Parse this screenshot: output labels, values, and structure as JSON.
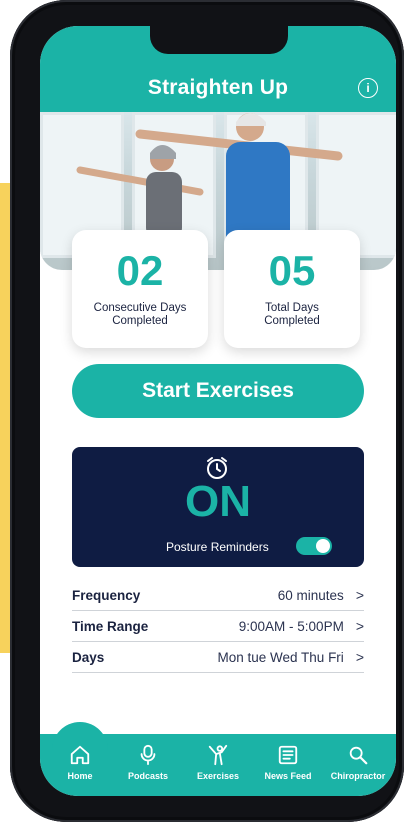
{
  "app": {
    "title": "Straighten Up",
    "info_icon": "info-icon"
  },
  "stats": [
    {
      "value": "02",
      "label": "Consecutive Days Completed"
    },
    {
      "value": "05",
      "label": "Total Days Completed"
    }
  ],
  "actions": {
    "start_label": "Start Exercises"
  },
  "reminder": {
    "status": "ON",
    "label": "Posture Reminders",
    "icon": "alarm-clock-icon",
    "enabled": true
  },
  "settings": [
    {
      "label": "Frequency",
      "value": "60 minutes"
    },
    {
      "label": "Time Range",
      "value": "9:00AM - 5:00PM"
    },
    {
      "label": "Days",
      "value": "Mon tue Wed Thu Fri"
    }
  ],
  "tabs": [
    {
      "label": "Home",
      "icon": "home-icon"
    },
    {
      "label": "Podcasts",
      "icon": "microphone-icon"
    },
    {
      "label": "Exercises",
      "icon": "exercise-figure-icon"
    },
    {
      "label": "News Feed",
      "icon": "newspaper-icon"
    },
    {
      "label": "Chiropractor",
      "icon": "search-icon"
    }
  ],
  "colors": {
    "accent": "#1bb3a6",
    "navy": "#0f1c43",
    "yellow": "#f7d25c"
  }
}
